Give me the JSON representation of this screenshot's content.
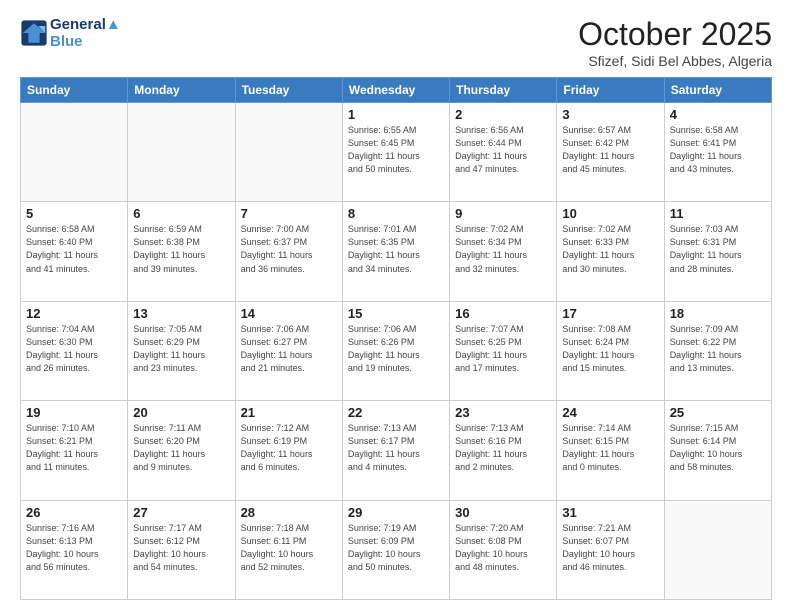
{
  "header": {
    "logo_line1": "General",
    "logo_line2": "Blue",
    "month": "October 2025",
    "location": "Sfizef, Sidi Bel Abbes, Algeria"
  },
  "weekdays": [
    "Sunday",
    "Monday",
    "Tuesday",
    "Wednesday",
    "Thursday",
    "Friday",
    "Saturday"
  ],
  "weeks": [
    [
      {
        "day": "",
        "info": ""
      },
      {
        "day": "",
        "info": ""
      },
      {
        "day": "",
        "info": ""
      },
      {
        "day": "1",
        "info": "Sunrise: 6:55 AM\nSunset: 6:45 PM\nDaylight: 11 hours\nand 50 minutes."
      },
      {
        "day": "2",
        "info": "Sunrise: 6:56 AM\nSunset: 6:44 PM\nDaylight: 11 hours\nand 47 minutes."
      },
      {
        "day": "3",
        "info": "Sunrise: 6:57 AM\nSunset: 6:42 PM\nDaylight: 11 hours\nand 45 minutes."
      },
      {
        "day": "4",
        "info": "Sunrise: 6:58 AM\nSunset: 6:41 PM\nDaylight: 11 hours\nand 43 minutes."
      }
    ],
    [
      {
        "day": "5",
        "info": "Sunrise: 6:58 AM\nSunset: 6:40 PM\nDaylight: 11 hours\nand 41 minutes."
      },
      {
        "day": "6",
        "info": "Sunrise: 6:59 AM\nSunset: 6:38 PM\nDaylight: 11 hours\nand 39 minutes."
      },
      {
        "day": "7",
        "info": "Sunrise: 7:00 AM\nSunset: 6:37 PM\nDaylight: 11 hours\nand 36 minutes."
      },
      {
        "day": "8",
        "info": "Sunrise: 7:01 AM\nSunset: 6:35 PM\nDaylight: 11 hours\nand 34 minutes."
      },
      {
        "day": "9",
        "info": "Sunrise: 7:02 AM\nSunset: 6:34 PM\nDaylight: 11 hours\nand 32 minutes."
      },
      {
        "day": "10",
        "info": "Sunrise: 7:02 AM\nSunset: 6:33 PM\nDaylight: 11 hours\nand 30 minutes."
      },
      {
        "day": "11",
        "info": "Sunrise: 7:03 AM\nSunset: 6:31 PM\nDaylight: 11 hours\nand 28 minutes."
      }
    ],
    [
      {
        "day": "12",
        "info": "Sunrise: 7:04 AM\nSunset: 6:30 PM\nDaylight: 11 hours\nand 26 minutes."
      },
      {
        "day": "13",
        "info": "Sunrise: 7:05 AM\nSunset: 6:29 PM\nDaylight: 11 hours\nand 23 minutes."
      },
      {
        "day": "14",
        "info": "Sunrise: 7:06 AM\nSunset: 6:27 PM\nDaylight: 11 hours\nand 21 minutes."
      },
      {
        "day": "15",
        "info": "Sunrise: 7:06 AM\nSunset: 6:26 PM\nDaylight: 11 hours\nand 19 minutes."
      },
      {
        "day": "16",
        "info": "Sunrise: 7:07 AM\nSunset: 6:25 PM\nDaylight: 11 hours\nand 17 minutes."
      },
      {
        "day": "17",
        "info": "Sunrise: 7:08 AM\nSunset: 6:24 PM\nDaylight: 11 hours\nand 15 minutes."
      },
      {
        "day": "18",
        "info": "Sunrise: 7:09 AM\nSunset: 6:22 PM\nDaylight: 11 hours\nand 13 minutes."
      }
    ],
    [
      {
        "day": "19",
        "info": "Sunrise: 7:10 AM\nSunset: 6:21 PM\nDaylight: 11 hours\nand 11 minutes."
      },
      {
        "day": "20",
        "info": "Sunrise: 7:11 AM\nSunset: 6:20 PM\nDaylight: 11 hours\nand 9 minutes."
      },
      {
        "day": "21",
        "info": "Sunrise: 7:12 AM\nSunset: 6:19 PM\nDaylight: 11 hours\nand 6 minutes."
      },
      {
        "day": "22",
        "info": "Sunrise: 7:13 AM\nSunset: 6:17 PM\nDaylight: 11 hours\nand 4 minutes."
      },
      {
        "day": "23",
        "info": "Sunrise: 7:13 AM\nSunset: 6:16 PM\nDaylight: 11 hours\nand 2 minutes."
      },
      {
        "day": "24",
        "info": "Sunrise: 7:14 AM\nSunset: 6:15 PM\nDaylight: 11 hours\nand 0 minutes."
      },
      {
        "day": "25",
        "info": "Sunrise: 7:15 AM\nSunset: 6:14 PM\nDaylight: 10 hours\nand 58 minutes."
      }
    ],
    [
      {
        "day": "26",
        "info": "Sunrise: 7:16 AM\nSunset: 6:13 PM\nDaylight: 10 hours\nand 56 minutes."
      },
      {
        "day": "27",
        "info": "Sunrise: 7:17 AM\nSunset: 6:12 PM\nDaylight: 10 hours\nand 54 minutes."
      },
      {
        "day": "28",
        "info": "Sunrise: 7:18 AM\nSunset: 6:11 PM\nDaylight: 10 hours\nand 52 minutes."
      },
      {
        "day": "29",
        "info": "Sunrise: 7:19 AM\nSunset: 6:09 PM\nDaylight: 10 hours\nand 50 minutes."
      },
      {
        "day": "30",
        "info": "Sunrise: 7:20 AM\nSunset: 6:08 PM\nDaylight: 10 hours\nand 48 minutes."
      },
      {
        "day": "31",
        "info": "Sunrise: 7:21 AM\nSunset: 6:07 PM\nDaylight: 10 hours\nand 46 minutes."
      },
      {
        "day": "",
        "info": ""
      }
    ]
  ]
}
